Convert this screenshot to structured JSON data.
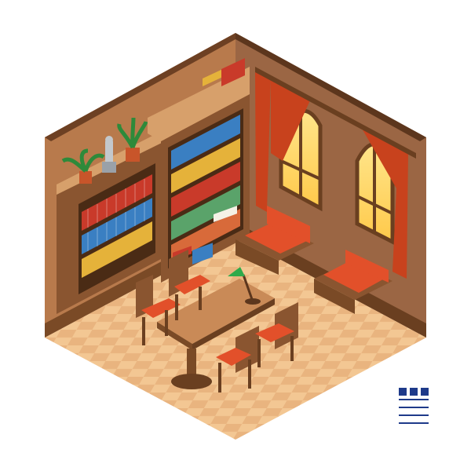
{
  "scene": {
    "description_visible_text": "",
    "colors": {
      "background": "#ffffff",
      "left_wall": "#b87a4c",
      "right_wall": "#9a6441",
      "floor_light": "#f3c793",
      "floor_mid": "#e7b07a",
      "wood_dark": "#7a4a26",
      "wood_light": "#c98a57",
      "upholstery": "#e2502a",
      "curtain": "#c8421d",
      "window_glass": "#ffd86a",
      "lamp_green": "#2faa4a"
    }
  }
}
